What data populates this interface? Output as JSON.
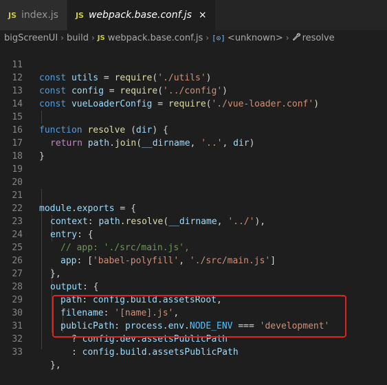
{
  "tabs": [
    {
      "badge": "JS",
      "label": "index.js",
      "active": false
    },
    {
      "badge": "JS",
      "label": "webpack.base.conf.js",
      "active": true,
      "close": "×"
    }
  ],
  "breadcrumb": {
    "items": [
      "bigScreenUI",
      "build"
    ],
    "file_badge": "JS",
    "file": "webpack.base.conf.js",
    "symbol_icon": "[⊙]",
    "symbol": "<unknown>",
    "wrench_icon": "wrench-icon",
    "property": "resolve"
  },
  "editor": {
    "lines": [
      {
        "n": "11"
      },
      {
        "n": "12"
      },
      {
        "n": "13"
      },
      {
        "n": "14"
      },
      {
        "n": "15"
      },
      {
        "n": "16"
      },
      {
        "n": "17"
      },
      {
        "n": "18"
      },
      {
        "n": "19"
      },
      {
        "n": "20"
      },
      {
        "n": "21"
      },
      {
        "n": "22"
      },
      {
        "n": "23"
      },
      {
        "n": "24"
      },
      {
        "n": "25"
      },
      {
        "n": "26"
      },
      {
        "n": "27"
      },
      {
        "n": "28"
      },
      {
        "n": "29"
      },
      {
        "n": "30"
      },
      {
        "n": "31"
      },
      {
        "n": "32"
      },
      {
        "n": "33"
      }
    ],
    "tokens": {
      "l11": [
        "const",
        " ",
        "utils",
        " = ",
        "require",
        "(",
        "'./utils'",
        ")"
      ],
      "l12": [
        "const",
        " ",
        "config",
        " = ",
        "require",
        "(",
        "'../config'",
        ")"
      ],
      "l13": [
        "const",
        " ",
        "vueLoaderConfig",
        " = ",
        "require",
        "(",
        "'./vue-loader.conf'",
        ")"
      ],
      "l15": [
        "function",
        " ",
        "resolve",
        " (",
        "dir",
        ") {"
      ],
      "l16": [
        "return",
        " ",
        "path",
        ".",
        "join",
        "(",
        "__dirname",
        ", ",
        "'..'",
        ", ",
        "dir",
        ")"
      ],
      "l17": [
        "}"
      ],
      "l21": [
        "module",
        ".",
        "exports",
        " = {"
      ],
      "l22": [
        "context",
        ": ",
        "path",
        ".",
        "resolve",
        "(",
        "__dirname",
        ", ",
        "'../'",
        "),"
      ],
      "l23": [
        "entry",
        ": {"
      ],
      "l24": [
        "// app: './src/main.js',"
      ],
      "l25": [
        "app",
        ": [",
        "'babel-polyfill'",
        ", ",
        "'./src/main.js'",
        "]"
      ],
      "l26": [
        "},"
      ],
      "l27": [
        "output",
        ": {"
      ],
      "l28": [
        "path",
        ": ",
        "config",
        ".",
        "build",
        ".",
        "assetsRoot",
        ","
      ],
      "l29": [
        "filename",
        ": ",
        "'[name].js'",
        ","
      ],
      "l30": [
        "publicPath",
        ": ",
        "process",
        ".",
        "env",
        ".",
        "NODE_ENV",
        " === ",
        "'development'"
      ],
      "l31": [
        "? ",
        "config",
        ".",
        "dev",
        ".",
        "assetsPublicPath"
      ],
      "l32": [
        ": ",
        "config",
        ".",
        "build",
        ".",
        "assetsPublicPath"
      ],
      "l33": [
        "},"
      ]
    }
  },
  "colors": {
    "background": "#1e1e1e",
    "keyword": "#569cd6",
    "string": "#ce9178",
    "variable": "#9cdcfe",
    "function": "#dcdcaa",
    "comment": "#6a9955",
    "highlight_box": "#e0231b"
  }
}
